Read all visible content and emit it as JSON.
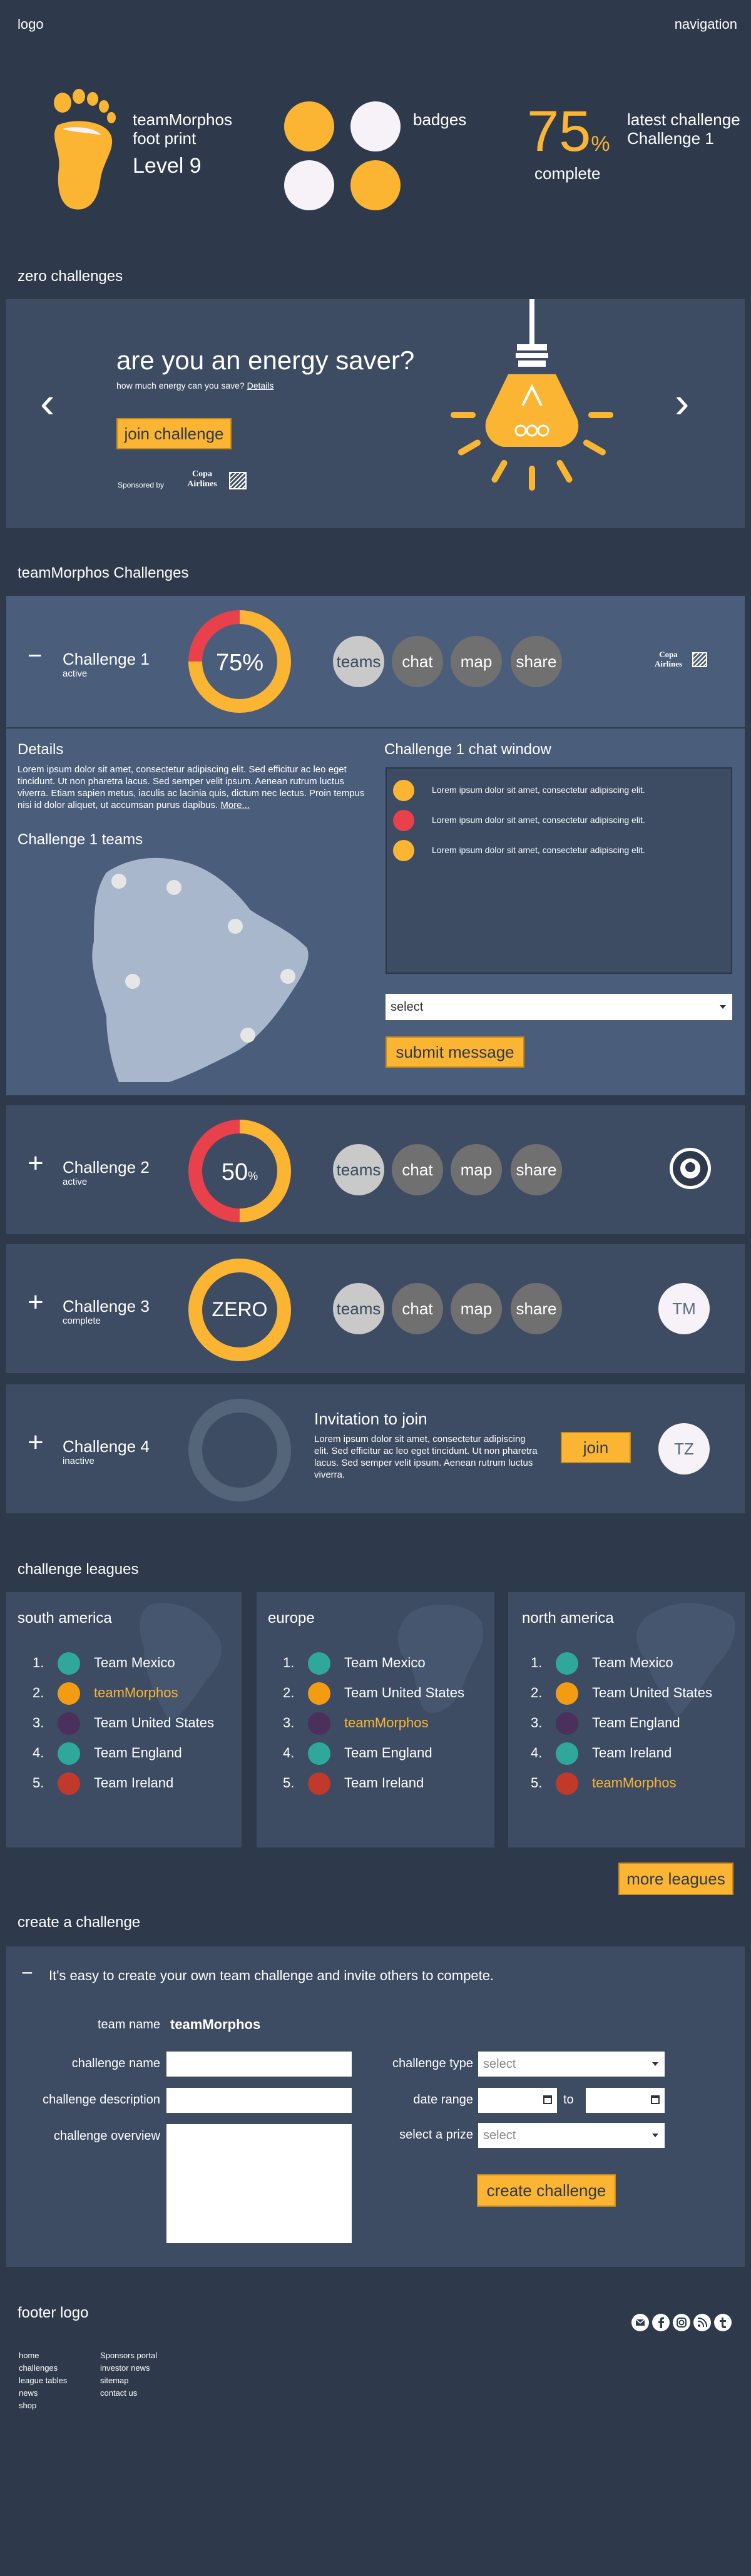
{
  "header": {
    "logo": "logo",
    "navigation": "navigation"
  },
  "profile": {
    "team": "teamMorphos",
    "subtitle": "foot print",
    "level": "Level 9"
  },
  "badges": {
    "label": "badges",
    "colors": [
      "#fbb532",
      "#f7f2f7",
      "#f7f2f7",
      "#fbb532"
    ]
  },
  "latest": {
    "percent": "75",
    "percent_sign": "%",
    "complete": "complete",
    "label": "latest challenge",
    "challenge": "Challenge 1"
  },
  "zero": {
    "section_title": "zero challenges",
    "headline": "are you an energy saver?",
    "subline": "how much energy can you save?",
    "details_link": "Details",
    "join_button": "join challenge",
    "sponsored_by": "Sponsored by",
    "sponsor": "Copa Airlines",
    "prev": "‹",
    "next": "›"
  },
  "challenges_title": "teamMorphos Challenges",
  "challenge1": {
    "toggle": "−",
    "name": "Challenge 1",
    "status": "active",
    "percent": "75%",
    "progress": 0.75,
    "buttons": [
      "teams",
      "chat",
      "map",
      "share"
    ],
    "sponsor": "Copa Airlines",
    "details_title": "Details",
    "details_text": "Lorem ipsum dolor sit amet, consectetur adipiscing elit. Sed efficitur ac leo eget tincidunt. Ut non pharetra lacus. Sed semper velit ipsum. Aenean rutrum luctus viverra. Etiam sapien metus, iaculis ac lacinia quis, dictum nec lectus. Proin tempus nisi id dolor aliquet, ut accumsan purus dapibus.",
    "more": "More...",
    "teams_title": "Challenge 1 teams",
    "chat_title": "Challenge 1 chat window",
    "chat": [
      {
        "color": "#fbb532",
        "text": "Lorem ipsum dolor sit amet, consectetur adipiscing elit."
      },
      {
        "color": "#e8414b",
        "text": "Lorem ipsum dolor sit amet, consectetur adipiscing elit."
      },
      {
        "color": "#fbb532",
        "text": "Lorem ipsum dolor sit amet, consectetur adipiscing elit."
      }
    ],
    "select_value": "select",
    "submit": "submit message"
  },
  "challenge2": {
    "toggle": "+",
    "name": "Challenge 2",
    "status": "active",
    "percent": "50",
    "percent_sign": "%",
    "progress": 0.5,
    "buttons": [
      "teams",
      "chat",
      "map",
      "share"
    ]
  },
  "challenge3": {
    "toggle": "+",
    "name": "Challenge 3",
    "status": "complete",
    "center": "ZERO",
    "buttons": [
      "teams",
      "chat",
      "map",
      "share"
    ],
    "avatar": "TM"
  },
  "challenge4": {
    "toggle": "+",
    "name": "Challenge 4",
    "status": "inactive",
    "invite_title": "Invitation to join",
    "invite_text": "Lorem ipsum dolor sit amet, consectetur adipiscing elit. Sed efficitur ac leo eget tincidunt. Ut non pharetra lacus. Sed semper velit ipsum. Aenean rutrum luctus viverra.",
    "join": "join",
    "avatar": "TZ"
  },
  "leagues": {
    "section_title": "challenge leagues",
    "more": "more leagues",
    "groups": [
      {
        "title": "south america",
        "rows": [
          {
            "num": "1.",
            "name": "Team Mexico",
            "hl": false
          },
          {
            "num": "2.",
            "name": "teamMorphos",
            "hl": true
          },
          {
            "num": "3.",
            "name": "Team United States",
            "hl": false
          },
          {
            "num": "4.",
            "name": "Team England",
            "hl": false
          },
          {
            "num": "5.",
            "name": "Team Ireland",
            "hl": false
          }
        ]
      },
      {
        "title": "europe",
        "rows": [
          {
            "num": "1.",
            "name": "Team Mexico",
            "hl": false
          },
          {
            "num": "2.",
            "name": "Team United States",
            "hl": false
          },
          {
            "num": "3.",
            "name": "teamMorphos",
            "hl": true
          },
          {
            "num": "4.",
            "name": "Team England",
            "hl": false
          },
          {
            "num": "5.",
            "name": "Team Ireland",
            "hl": false
          }
        ]
      },
      {
        "title": "north america",
        "rows": [
          {
            "num": "1.",
            "name": "Team Mexico",
            "hl": false
          },
          {
            "num": "2.",
            "name": "Team United States",
            "hl": false
          },
          {
            "num": "3.",
            "name": "Team England",
            "hl": false
          },
          {
            "num": "4.",
            "name": "Team Ireland",
            "hl": false
          },
          {
            "num": "5.",
            "name": "teamMorphos",
            "hl": true
          }
        ]
      }
    ]
  },
  "create": {
    "section_title": "create a challenge",
    "toggle": "−",
    "intro": "It's easy to create your own team challenge and invite others to compete.",
    "team_name_label": "team name",
    "team_name_value": "teamMorphos",
    "challenge_name_label": "challenge name",
    "challenge_description_label": "challenge description",
    "challenge_overview_label": "challenge overview",
    "challenge_type_label": "challenge type",
    "challenge_type_value": "select",
    "date_range_label": "date range",
    "to": "to",
    "prize_label": "select a prize",
    "prize_value": "select",
    "submit": "create challenge"
  },
  "footer": {
    "logo": "footer logo",
    "col1": [
      "home",
      "challenges",
      "league tables",
      "news",
      "shop"
    ],
    "col2": [
      "Sponsors portal",
      "investor news",
      "sitemap",
      "contact us"
    ]
  }
}
